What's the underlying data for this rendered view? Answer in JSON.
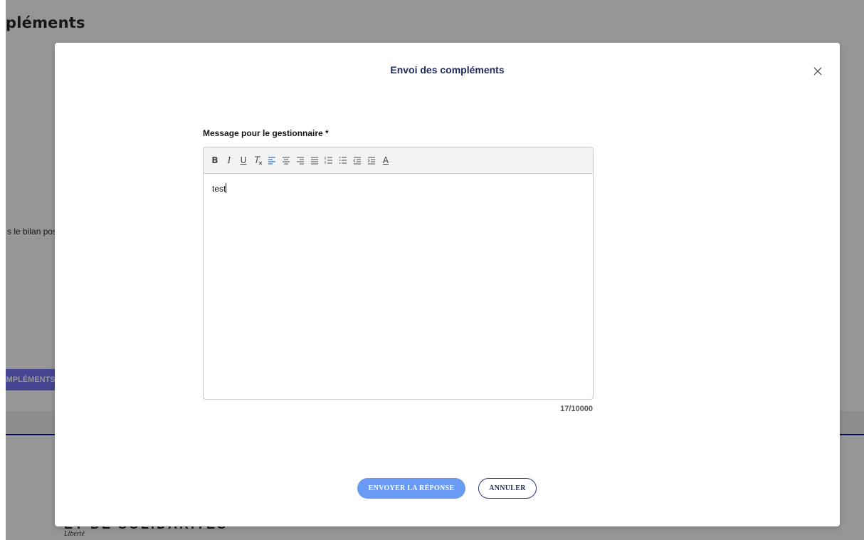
{
  "background": {
    "page_title": "pléments",
    "text_fragment": "s le bilan poss",
    "button_fragment": "OMPLÉMENTS",
    "footer_title": "ET DE SOLIDARITÉS",
    "footer_subtitle": "Liberté"
  },
  "modal": {
    "title": "Envoi des compléments",
    "field_label": "Message pour le gestionnaire *",
    "editor_value": "test",
    "char_count": "17/10000",
    "submit_label": "ENVOYER LA RÉPONSE",
    "cancel_label": "ANNULER"
  },
  "toolbar": {
    "icons": [
      "bold-icon",
      "italic-icon",
      "underline-icon",
      "clear-format-icon",
      "align-left-icon",
      "align-center-icon",
      "align-right-icon",
      "align-justify-icon",
      "ordered-list-icon",
      "bullet-list-icon",
      "outdent-icon",
      "indent-icon",
      "text-color-icon"
    ],
    "bold": "B",
    "italic": "I",
    "underline": "U",
    "text_color": "A"
  },
  "colors": {
    "overlay": "#161616",
    "primary_button": "#6a9bf4",
    "title": "#1e2a5a",
    "active_align": "#3a7bd5"
  }
}
